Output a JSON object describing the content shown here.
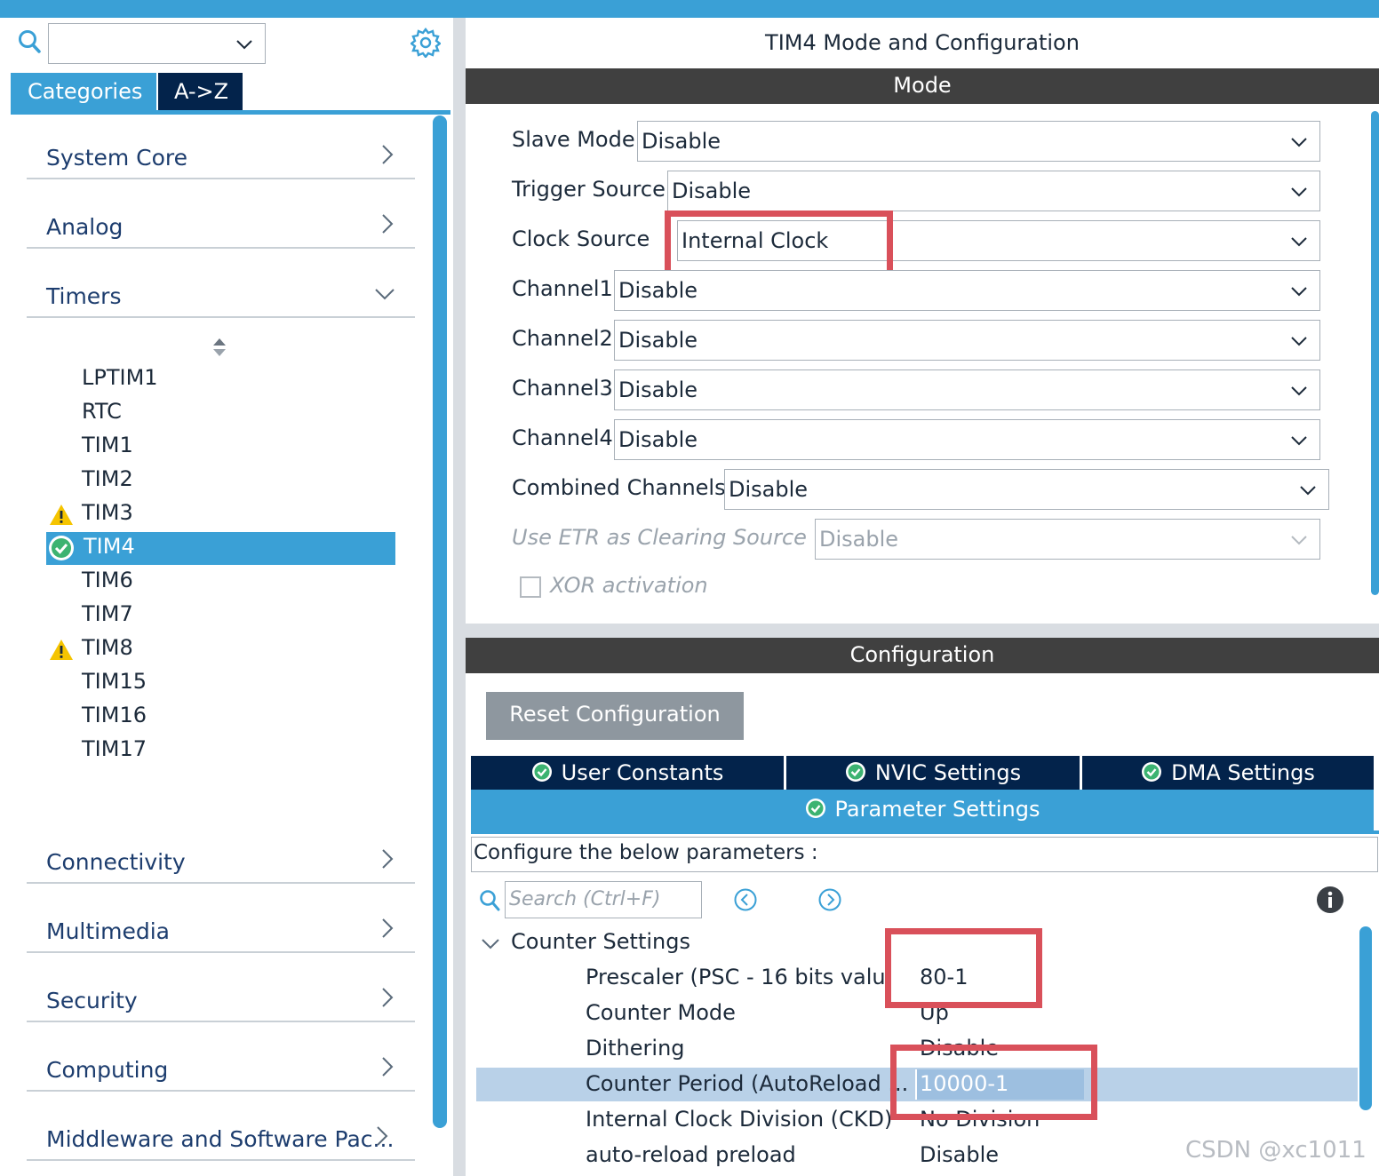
{
  "sidebar": {
    "search": {
      "value": "",
      "placeholder": ""
    },
    "tabs": [
      {
        "label": "Categories",
        "active": true
      },
      {
        "label": "A->Z",
        "active": false
      }
    ],
    "categories_top": [
      {
        "label": "System Core",
        "expanded": false
      },
      {
        "label": "Analog",
        "expanded": false
      },
      {
        "label": "Timers",
        "expanded": true
      }
    ],
    "timers": [
      {
        "label": "LPTIM1",
        "status": "none"
      },
      {
        "label": "RTC",
        "status": "none"
      },
      {
        "label": "TIM1",
        "status": "none"
      },
      {
        "label": "TIM2",
        "status": "none"
      },
      {
        "label": "TIM3",
        "status": "warning"
      },
      {
        "label": "TIM4",
        "status": "ok",
        "selected": true
      },
      {
        "label": "TIM6",
        "status": "none"
      },
      {
        "label": "TIM7",
        "status": "none"
      },
      {
        "label": "TIM8",
        "status": "warning"
      },
      {
        "label": "TIM15",
        "status": "none"
      },
      {
        "label": "TIM16",
        "status": "none"
      },
      {
        "label": "TIM17",
        "status": "none"
      }
    ],
    "categories_bottom": [
      {
        "label": "Connectivity"
      },
      {
        "label": "Multimedia"
      },
      {
        "label": "Security"
      },
      {
        "label": "Computing"
      },
      {
        "label": "Middleware and Software Pac..."
      }
    ]
  },
  "main": {
    "title": "TIM4 Mode and Configuration",
    "mode_header": "Mode",
    "mode_fields": [
      {
        "label": "Slave Mode",
        "value": "Disable"
      },
      {
        "label": "Trigger Source",
        "value": "Disable"
      },
      {
        "label": "Clock Source",
        "value": "Internal Clock",
        "highlighted": true
      },
      {
        "label": "Channel1",
        "value": "Disable"
      },
      {
        "label": "Channel2",
        "value": "Disable"
      },
      {
        "label": "Channel3",
        "value": "Disable"
      },
      {
        "label": "Channel4",
        "value": "Disable"
      },
      {
        "label": "Combined Channels",
        "value": "Disable"
      },
      {
        "label": "Use ETR as Clearing Source",
        "value": "Disable",
        "disabled": true
      }
    ],
    "xor": {
      "label": "XOR activation",
      "checked": false,
      "disabled": true
    },
    "config_header": "Configuration",
    "reset_button": "Reset Configuration",
    "config_tabs": [
      {
        "label": "User Constants"
      },
      {
        "label": "NVIC Settings"
      },
      {
        "label": "DMA Settings"
      }
    ],
    "active_tab": "Parameter Settings",
    "config_description": "Configure the below parameters :",
    "param_search_placeholder": "Search (Ctrl+F)",
    "group_label": "Counter Settings",
    "params": [
      {
        "name": "Prescaler (PSC - 16 bits valu",
        "value": "80-1",
        "highlighted": true
      },
      {
        "name": "Counter Mode",
        "value": "Up"
      },
      {
        "name": "Dithering",
        "value": "Disable"
      },
      {
        "name": "Counter Period (AutoReload ...",
        "value": "10000-1",
        "selected": true,
        "highlighted": true
      },
      {
        "name": "Internal Clock Division (CKD)",
        "value": "No Division"
      },
      {
        "name": "auto-reload preload",
        "value": "Disable"
      }
    ]
  },
  "watermark": "CSDN @xc1011",
  "colors": {
    "accent": "#3aa0d6",
    "dark_navy": "#03234b",
    "section_bar": "#404040",
    "annotation_red": "#d9505a",
    "warning": "#f5c400",
    "ok_green": "#3cb371"
  }
}
